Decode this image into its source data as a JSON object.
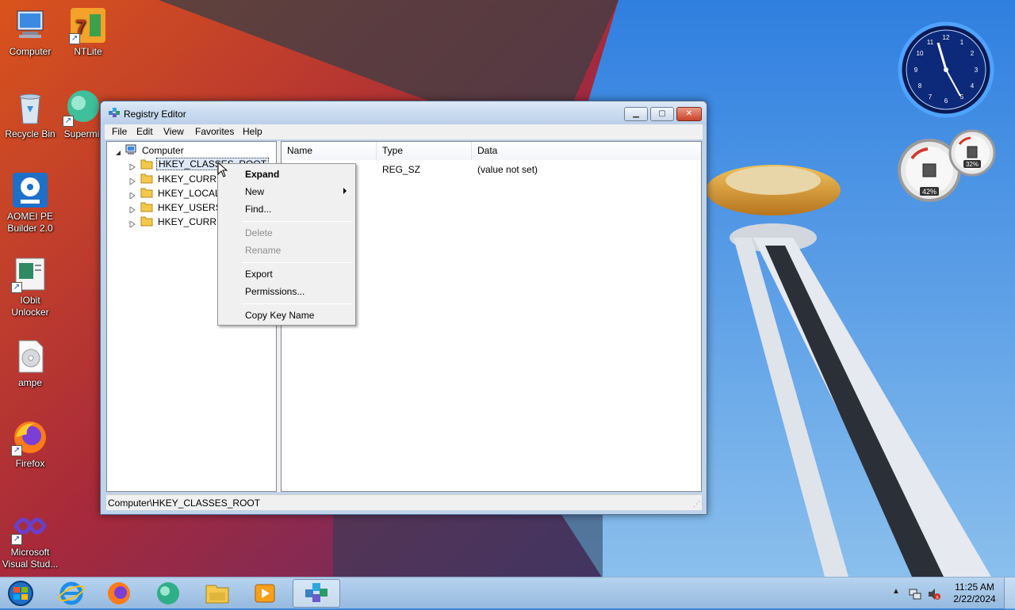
{
  "desktop": {
    "icons": [
      {
        "label": "Computer",
        "icon": "computer-icon"
      },
      {
        "label": "NTLite",
        "icon": "ntlite-icon"
      },
      {
        "label": "Recycle Bin",
        "icon": "recycle-bin-icon"
      },
      {
        "label": "Supermi",
        "icon": "superminer-icon"
      },
      {
        "label": "AOMEI PE Builder 2.0",
        "icon": "aomei-icon"
      },
      {
        "label": "IObit Unlocker",
        "icon": "iobit-unlocker-icon"
      },
      {
        "label": "ampe",
        "icon": "disc-file-icon"
      },
      {
        "label": "Firefox",
        "icon": "firefox-icon"
      },
      {
        "label": "Microsoft Visual Stud...",
        "icon": "visual-studio-icon"
      }
    ]
  },
  "gadgets": {
    "clock_numbers": [
      "12",
      "1",
      "2",
      "3",
      "4",
      "5",
      "6",
      "7",
      "8",
      "9",
      "10",
      "11"
    ],
    "meter_cpu": "42%",
    "meter_ram": "32%"
  },
  "window": {
    "title": "Registry Editor",
    "menu": [
      "File",
      "Edit",
      "View",
      "Favorites",
      "Help"
    ],
    "tree": {
      "root": "Computer",
      "keys": [
        "HKEY_CLASSES_ROOT",
        "HKEY_CURREN",
        "HKEY_LOCAL_",
        "HKEY_USERS",
        "HKEY_CURREN"
      ]
    },
    "columns": [
      "Name",
      "Type",
      "Data"
    ],
    "rows": [
      {
        "name": "",
        "type": "REG_SZ",
        "data": "(value not set)"
      }
    ],
    "status": "Computer\\HKEY_CLASSES_ROOT"
  },
  "context_menu": {
    "items": [
      {
        "label": "Expand",
        "bold": true,
        "enabled": true
      },
      {
        "label": "New",
        "submenu": true,
        "enabled": true
      },
      {
        "label": "Find...",
        "enabled": true
      },
      {
        "label": "Delete",
        "enabled": false
      },
      {
        "label": "Rename",
        "enabled": false
      },
      {
        "label": "Export",
        "enabled": true
      },
      {
        "label": "Permissions...",
        "enabled": true
      },
      {
        "label": "Copy Key Name",
        "enabled": true
      }
    ]
  },
  "taskbar": {
    "apps": [
      "start-orb",
      "internet-explorer-icon",
      "firefox-icon",
      "superminer-icon",
      "file-explorer-icon",
      "media-player-icon",
      "registry-editor-icon"
    ],
    "time": "11:25 AM",
    "date": "2/22/2024"
  },
  "colors": {
    "sky": "#3a86d6",
    "window_frame": "#bfd3ea",
    "selection": "#dde9f8"
  }
}
